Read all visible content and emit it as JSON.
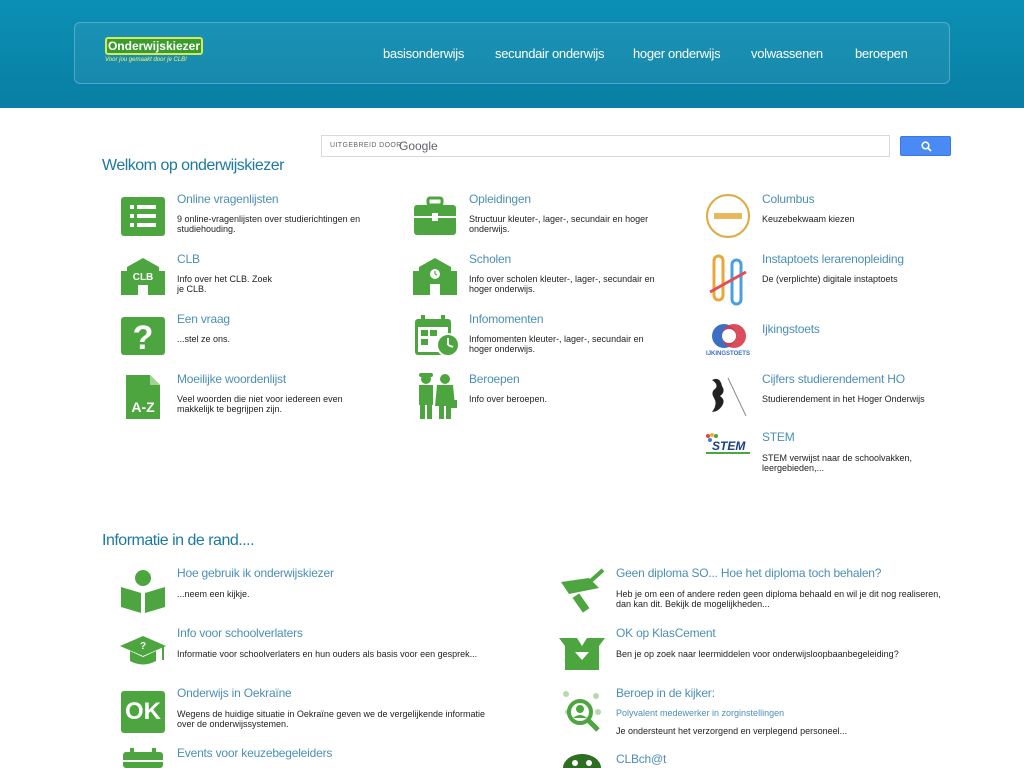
{
  "header": {
    "logo_text": "Onderwijskiezer",
    "logo_tagline": "Voor jou gemaakt door je CLB!",
    "nav": [
      "basisonderwijs",
      "secundair onderwijs",
      "hoger onderwijs",
      "volwassenen",
      "beroepen"
    ]
  },
  "search": {
    "by_label": "UITGEBREID DOOR",
    "brand": "Google"
  },
  "welcome": {
    "title": "Welkom op onderwijskiezer",
    "items": [
      {
        "title": "Online vragenlijsten",
        "desc": "9 online-vragenlijsten over studierichtingen en studiehouding.",
        "icon": "list-icon"
      },
      {
        "title": "Opleidingen",
        "desc": "Structuur kleuter-, lager-, secundair en hoger onderwijs.",
        "icon": "briefcase-icon"
      },
      {
        "title": "Columbus",
        "desc": "Keuzebekwaam kiezen",
        "icon": "columbus-logo"
      },
      {
        "title": "CLB",
        "desc": "Info over het CLB. Zoek je CLB.",
        "icon": "clb-building-icon"
      },
      {
        "title": "Scholen",
        "desc": "Info over scholen kleuter-, lager-, secundair en hoger onderwijs.",
        "icon": "school-icon"
      },
      {
        "title": "Instaptoets lerarenopleiding",
        "desc": "De (verplichte) digitale instaptoets",
        "icon": "instaptoets-logo"
      },
      {
        "title": "Een vraag",
        "desc": "...stel ze ons.",
        "icon": "question-icon"
      },
      {
        "title": "Infomomenten",
        "desc": "Infomomenten kleuter-, lager-, secundair en hoger onderwijs.",
        "icon": "calendar-clock-icon"
      },
      {
        "title": "Ijkingstoets",
        "desc": "",
        "icon": "ijkingstoets-logo",
        "logo_text": "IJKINGSTOETS"
      },
      {
        "title": "Moeilijke woordenlijst",
        "desc": "Veel woorden die niet voor iedereen even makkelijk te begrijpen zijn.",
        "icon": "a-z-document-icon"
      },
      {
        "title": "Beroepen",
        "desc": "Info over beroepen.",
        "icon": "workers-icon"
      },
      {
        "title": "Cijfers studierendement HO",
        "desc": "Studierendement in het Hoger Onderwijs",
        "icon": "flemish-lion-logo"
      },
      {
        "title": "STEM",
        "desc": "STEM verwijst naar de schoolvakken, leergebieden,...",
        "icon": "stem-logo",
        "logo_text": "STEM"
      }
    ]
  },
  "rand": {
    "title": "Informatie in de rand....",
    "items": [
      {
        "title": "Hoe gebruik ik onderwijskiezer",
        "desc": "...neem een kijkje.",
        "icon": "reader-icon"
      },
      {
        "title": "Geen diploma SO... Hoe het diploma toch behalen?",
        "desc": "Heb je om een of andere reden geen diploma behaald en wil je dit nog realiseren, dan kan dit. Bekijk de mogelijkheden...",
        "icon": "diploma-icon"
      },
      {
        "title": "Info voor schoolverlaters",
        "desc": "Informatie voor schoolverlaters en hun ouders als basis voor een gesprek...",
        "icon": "graduation-cap-icon"
      },
      {
        "title": "OK op KlasCement",
        "desc": "Ben je op zoek naar leermiddelen voor onderwijsloopbaanbegeleiding?",
        "icon": "open-box-icon"
      },
      {
        "title": "Onderwijs in Oekraïne",
        "desc": "Wegens de huidige situatie in Oekraïne geven we de vergelijkende informatie over de onderwijssystemen.",
        "icon": "ok-icon",
        "icon_text": "OK"
      },
      {
        "title": "Beroep in de kijker:",
        "subtitle": "Polyvalent medewerker in zorginstellingen",
        "desc": "Je ondersteunt het verzorgend en verplegend personeel...",
        "icon": "magnifier-person-icon"
      },
      {
        "title": "Events voor keuzebegeleiders",
        "desc": "",
        "icon": "calendar-icon"
      },
      {
        "title": "CLBch@t",
        "desc": "",
        "icon": "chat-icon"
      }
    ]
  }
}
